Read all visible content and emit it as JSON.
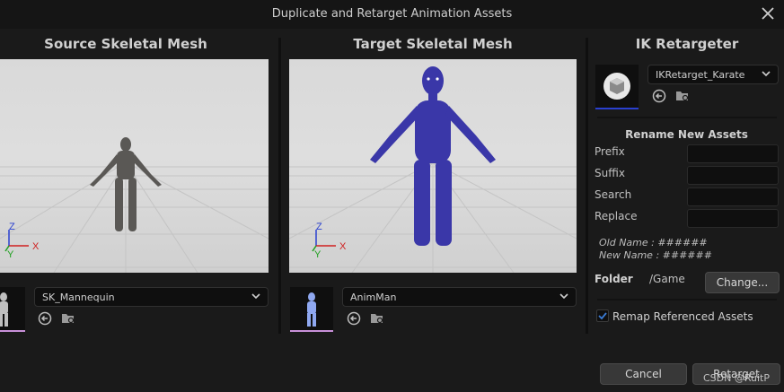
{
  "window": {
    "title": "Duplicate and Retarget Animation Assets"
  },
  "source": {
    "header": "Source Skeletal Mesh",
    "mesh": "SK_Mannequin"
  },
  "target": {
    "header": "Target Skeletal Mesh",
    "mesh": "AnimMan"
  },
  "axes": {
    "z": "Z",
    "x": "X",
    "y": "Y"
  },
  "ik": {
    "header": "IK Retargeter",
    "asset": "IKRetarget_Karate",
    "rename_header": "Rename New Assets",
    "fields": [
      {
        "label": "Prefix",
        "value": ""
      },
      {
        "label": "Suffix",
        "value": ""
      },
      {
        "label": "Search",
        "value": ""
      },
      {
        "label": "Replace",
        "value": ""
      }
    ],
    "old_name": "Old Name : ######",
    "new_name": "New Name : ######",
    "folder_label": "Folder",
    "folder_value": "/Game",
    "change_label": "Change...",
    "remap_label": "Remap Referenced Assets",
    "remap_checked": true
  },
  "actions": {
    "cancel": "Cancel",
    "retarget": "Retarget"
  },
  "watermark": "CSDN @RuitP",
  "colors": {
    "target_mesh": "#3a37a8",
    "source_mesh": "#5a5855",
    "accent": "#3a7bd5"
  }
}
